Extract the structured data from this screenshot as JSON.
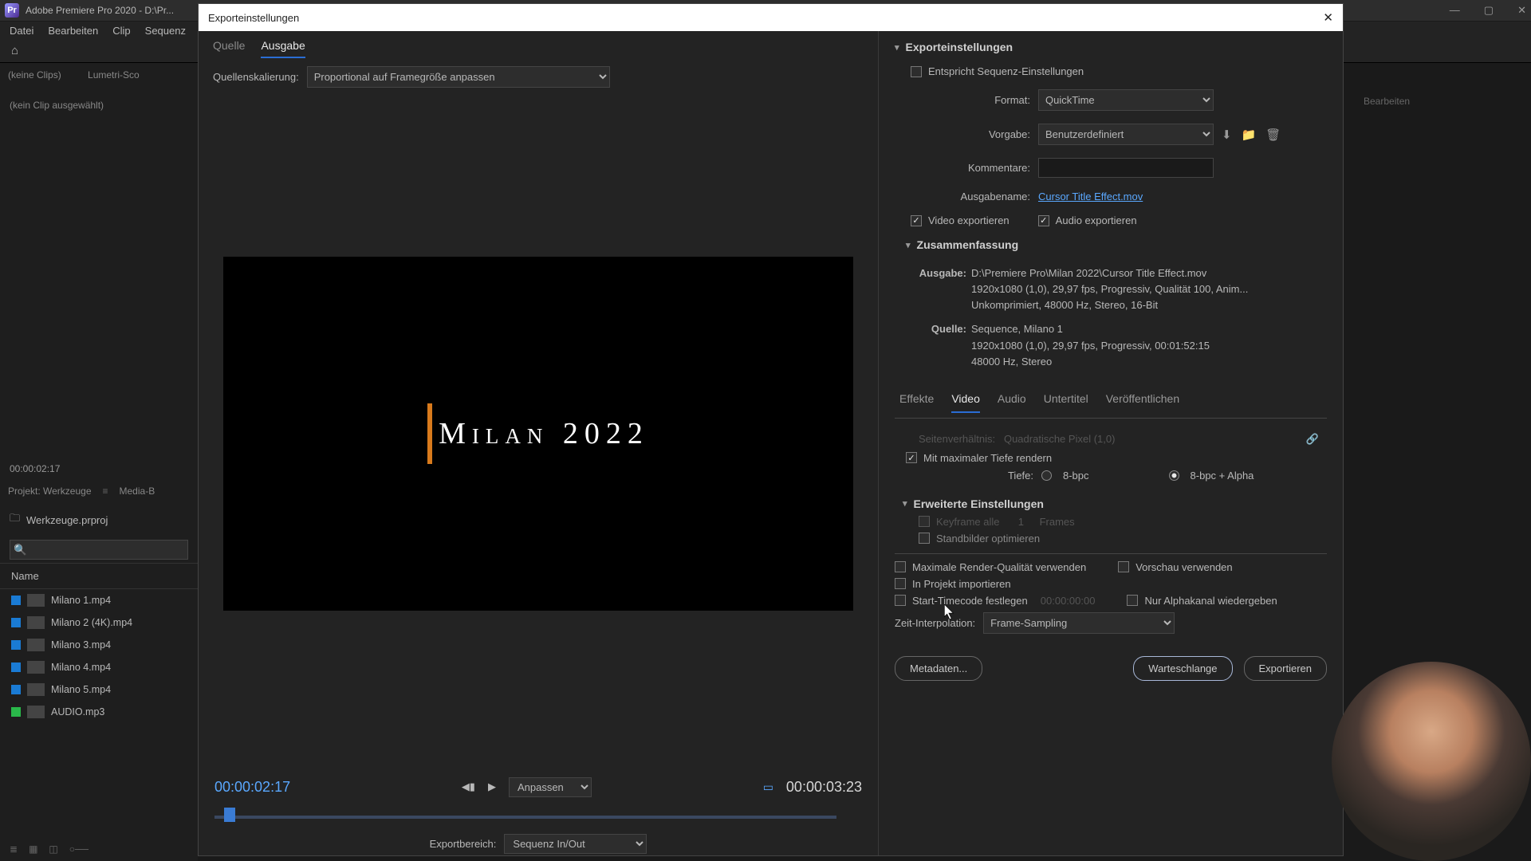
{
  "app": {
    "title": "Adobe Premiere Pro 2020 - D:\\Pr...",
    "logo_char": "Pr"
  },
  "menu": [
    "Datei",
    "Bearbeiten",
    "Clip",
    "Sequenz"
  ],
  "source_panel": {
    "label": "(keine Clips)",
    "right": "Lumetri-Sco",
    "noclip": "(kein Clip ausgewählt)",
    "tc": "00:00:02:17"
  },
  "project": {
    "tab1": "Projekt: Werkzeuge",
    "tab2": "Media-B",
    "name": "Werkzeuge.prproj",
    "name_col": "Name",
    "assets": [
      {
        "color": "blue",
        "label": "Milano 1.mp4"
      },
      {
        "color": "blue",
        "label": "Milano 2 (4K).mp4"
      },
      {
        "color": "blue",
        "label": "Milano 3.mp4"
      },
      {
        "color": "blue",
        "label": "Milano 4.mp4"
      },
      {
        "color": "blue",
        "label": "Milano 5.mp4"
      },
      {
        "color": "green",
        "label": "AUDIO.mp3"
      }
    ]
  },
  "bg_right": {
    "tab": "Bearbeiten"
  },
  "dialog": {
    "title": "Exporteinstellungen",
    "tabs": {
      "source": "Quelle",
      "output": "Ausgabe"
    },
    "scale_label": "Quellenskalierung:",
    "scale_value": "Proportional auf Framegröße anpassen",
    "preview_title": "Milan 2022",
    "tc_left": "00:00:02:17",
    "fit": "Anpassen",
    "tc_right": "00:00:03:23",
    "range_label": "Exportbereich:",
    "range_value": "Sequenz In/Out"
  },
  "settings": {
    "head": "Exporteinstellungen",
    "match": "Entspricht Sequenz-Einstellungen",
    "format_label": "Format:",
    "format_value": "QuickTime",
    "preset_label": "Vorgabe:",
    "preset_value": "Benutzerdefiniert",
    "comments_label": "Kommentare:",
    "output_label": "Ausgabename:",
    "output_link": "Cursor Title Effect.mov",
    "export_video": "Video exportieren",
    "export_audio": "Audio exportieren",
    "summary_head": "Zusammenfassung",
    "summary_out_lbl": "Ausgabe:",
    "summary_out_1": "D:\\Premiere Pro\\Milan 2022\\Cursor Title Effect.mov",
    "summary_out_2": "1920x1080 (1,0), 29,97 fps, Progressiv, Qualität 100, Anim...",
    "summary_out_3": "Unkomprimiert, 48000 Hz, Stereo, 16-Bit",
    "summary_src_lbl": "Quelle:",
    "summary_src_1": "Sequence, Milano 1",
    "summary_src_2": "1920x1080 (1,0), 29,97 fps, Progressiv, 00:01:52:15",
    "summary_src_3": "48000 Hz, Stereo"
  },
  "tabs2": [
    "Effekte",
    "Video",
    "Audio",
    "Untertitel",
    "Veröffentlichen"
  ],
  "video": {
    "aspect_lbl": "Seitenverhältnis:",
    "aspect_val": "Quadratische Pixel (1,0)",
    "max_depth": "Mit maximaler Tiefe rendern",
    "depth_lbl": "Tiefe:",
    "r8": "8-bpc",
    "r8a": "8-bpc + Alpha",
    "adv_head": "Erweiterte Einstellungen",
    "keyframe": "Keyframe alle",
    "keyframe_n": "1",
    "keyframe_u": "Frames",
    "stills": "Standbilder optimieren"
  },
  "bottom": {
    "max_render": "Maximale Render-Qualität verwenden",
    "preview": "Vorschau verwenden",
    "import": "In Projekt importieren",
    "start_tc": "Start-Timecode festlegen",
    "tc_val": "00:00:00:00",
    "alpha": "Nur Alphakanal wiedergeben",
    "interp_label": "Zeit-Interpolation:",
    "interp_val": "Frame-Sampling"
  },
  "buttons": {
    "metadata": "Metadaten...",
    "queue": "Warteschlange",
    "export": "Exportieren"
  }
}
